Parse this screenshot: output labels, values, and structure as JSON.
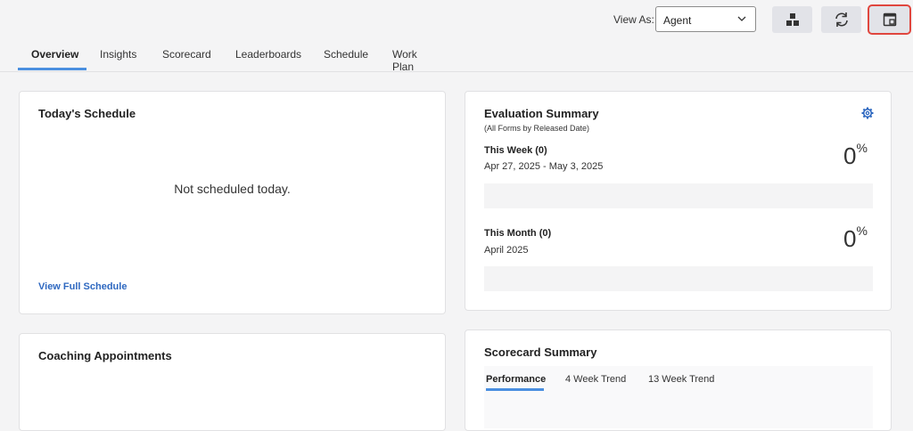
{
  "header": {
    "view_as_label": "View As:",
    "view_as_value": "Agent"
  },
  "tabs": [
    {
      "label": "Overview"
    },
    {
      "label": "Insights"
    },
    {
      "label": "Scorecard"
    },
    {
      "label": "Leaderboards"
    },
    {
      "label": "Schedule"
    },
    {
      "label": "Work Plan"
    }
  ],
  "schedule_card": {
    "title": "Today's Schedule",
    "empty_text": "Not scheduled today.",
    "link": "View Full Schedule"
  },
  "evaluation_card": {
    "title": "Evaluation Summary",
    "subtitle": "(All Forms by Released Date)",
    "week_label": "This Week (0)",
    "week_range": "Apr 27, 2025 - May 3, 2025",
    "week_pct": "0",
    "month_label": "This Month (0)",
    "month_range": "April 2025",
    "month_pct": "0",
    "pct_unit": "%"
  },
  "coaching_card": {
    "title": "Coaching Appointments"
  },
  "scorecard_card": {
    "title": "Scorecard Summary",
    "tabs": [
      "Performance",
      "4 Week Trend",
      "13 Week Trend"
    ]
  },
  "colors": {
    "accent": "#4a8fe0",
    "link": "#2e68c0",
    "highlight": "#e0463e"
  },
  "icons": [
    "chevron-down-icon",
    "org-chart-icon",
    "refresh-icon",
    "popout-window-icon",
    "gear-icon"
  ]
}
